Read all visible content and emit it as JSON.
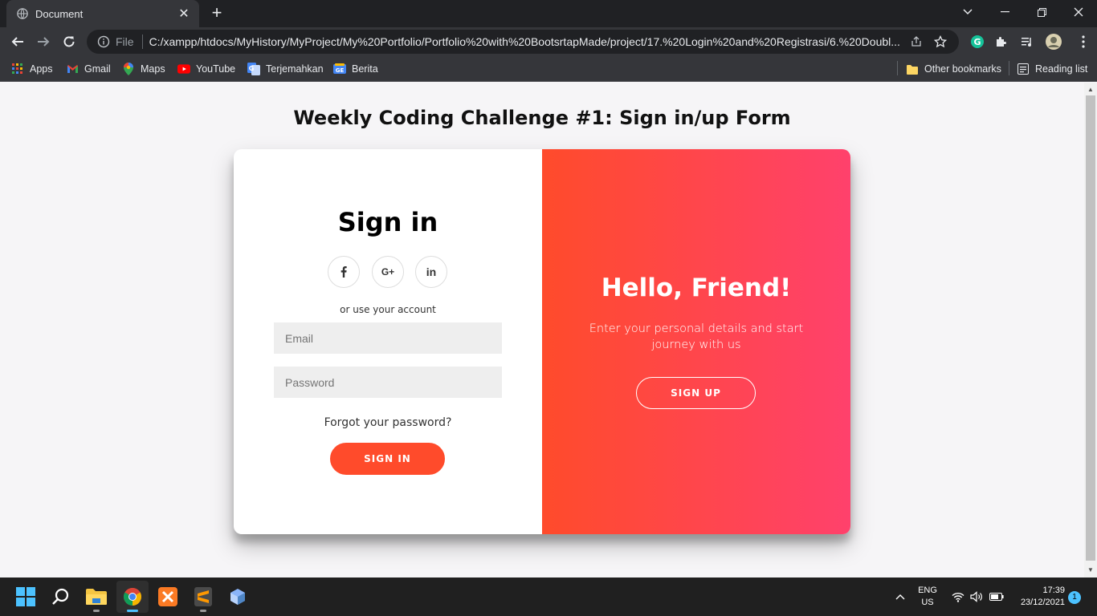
{
  "browser": {
    "tab_title": "Document",
    "url_scheme_label": "File",
    "url": "C:/xampp/htdocs/MyHistory/MyProject/My%20Portfolio/Portfolio%20with%20BootsrtapMade/project/17.%20Login%20and%20Registrasi/6.%20Doubl...",
    "bookmarks": [
      {
        "label": "Apps",
        "icon": "apps-grid-icon"
      },
      {
        "label": "Gmail",
        "icon": "gmail-icon"
      },
      {
        "label": "Maps",
        "icon": "maps-icon"
      },
      {
        "label": "YouTube",
        "icon": "youtube-icon"
      },
      {
        "label": "Terjemahkan",
        "icon": "translate-icon"
      },
      {
        "label": "Berita",
        "icon": "news-icon"
      }
    ],
    "other_bookmarks": "Other bookmarks",
    "reading_list": "Reading list"
  },
  "page": {
    "heading": "Weekly Coding Challenge #1: Sign in/up Form",
    "signin": {
      "title": "Sign in",
      "social": [
        {
          "label": "f",
          "icon": "facebook-icon"
        },
        {
          "label": "G+",
          "icon": "google-plus-icon"
        },
        {
          "label": "in",
          "icon": "linkedin-icon"
        }
      ],
      "use_account": "or use your account",
      "email_placeholder": "Email",
      "password_placeholder": "Password",
      "forgot": "Forgot your password?",
      "button": "SIGN IN"
    },
    "overlay": {
      "title": "Hello, Friend!",
      "text": "Enter your personal details and start journey with us",
      "button": "SIGN UP"
    }
  },
  "taskbar": {
    "lang_line1": "ENG",
    "lang_line2": "US",
    "time": "17:39",
    "date": "23/12/2021",
    "notifications": "1"
  },
  "colors": {
    "accent": "#ff4b2b",
    "gradient_end": "#ff416c"
  }
}
